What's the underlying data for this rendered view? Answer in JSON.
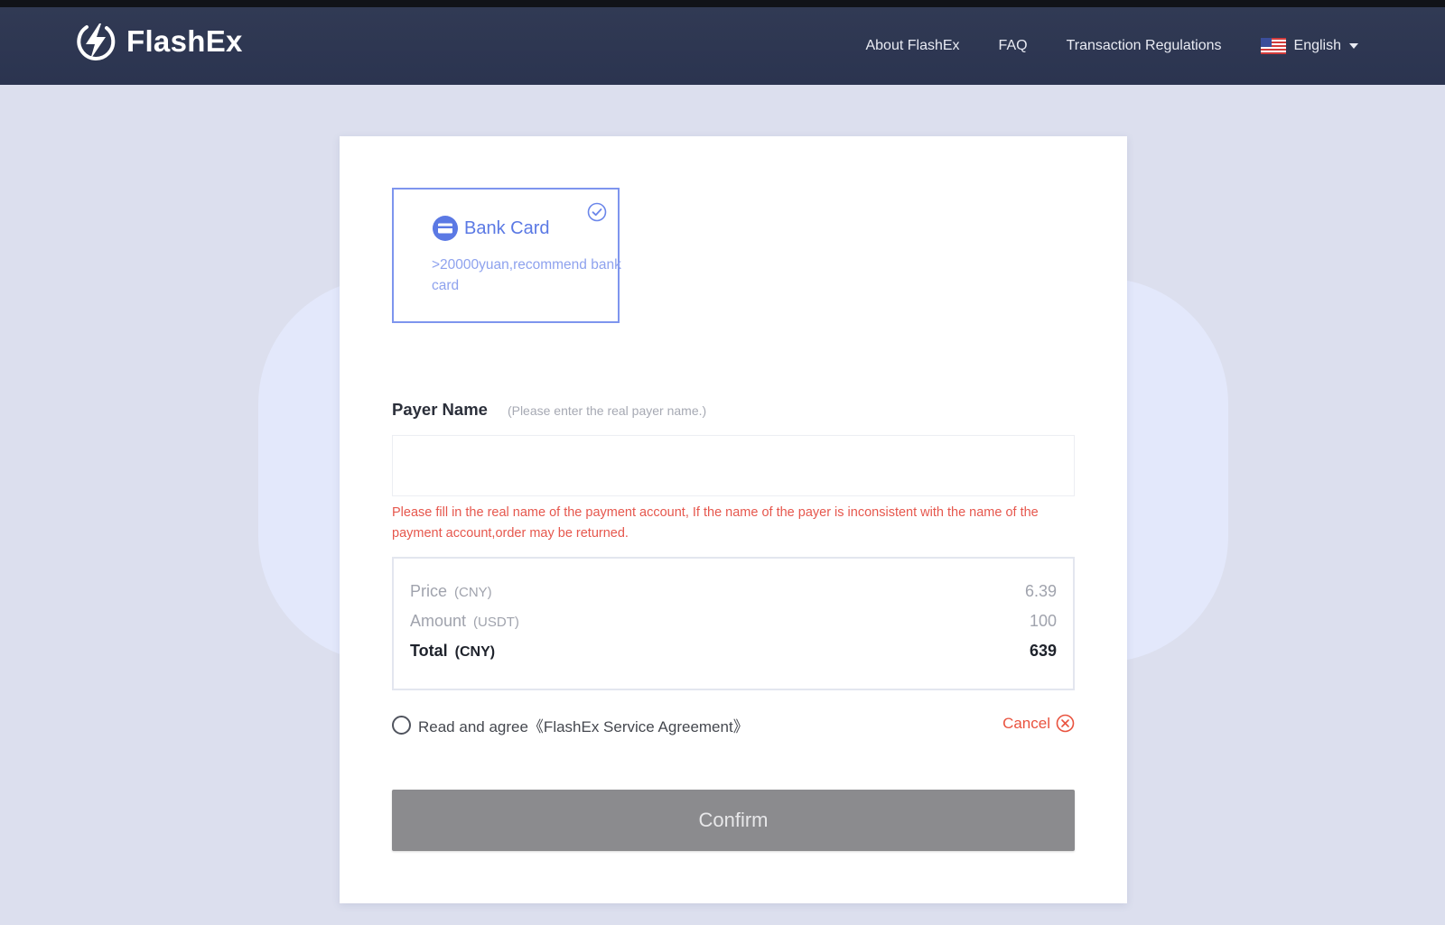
{
  "brand": {
    "name": "FlashEx",
    "icon": "lightning-bolt-icon"
  },
  "nav": {
    "links": [
      "About FlashEx",
      "FAQ",
      "Transaction Regulations"
    ],
    "language": {
      "label": "English",
      "flag": "us-flag-icon"
    }
  },
  "payment_method": {
    "title": "Bank Card",
    "description": ">20000yuan,recommend bank card",
    "selected": true,
    "icon": "credit-card-icon"
  },
  "payer": {
    "label": "Payer Name",
    "hint": "(Please enter the real payer name.)",
    "value": "",
    "warning": "Please fill in the real name of the payment account, If the name of the payer is inconsistent with the name of the payment account,order may be returned."
  },
  "summary": {
    "price": {
      "label": "Price",
      "unit": "(CNY)",
      "value": "6.39"
    },
    "amount": {
      "label": "Amount",
      "unit": "(USDT)",
      "value": "100"
    },
    "total": {
      "label": "Total",
      "unit": "(CNY)",
      "value": "639"
    }
  },
  "agreement": {
    "text": "Read and agree《FlashEx Service Agreement》",
    "checked": false
  },
  "cancel_label": "Cancel",
  "confirm_label": "Confirm",
  "colors": {
    "navbar": "#2e3752",
    "accent": "#5b79e4",
    "warning": "#e6574d",
    "confirm_disabled": "#8b8b8e",
    "page_bg": "#dcdfee"
  }
}
